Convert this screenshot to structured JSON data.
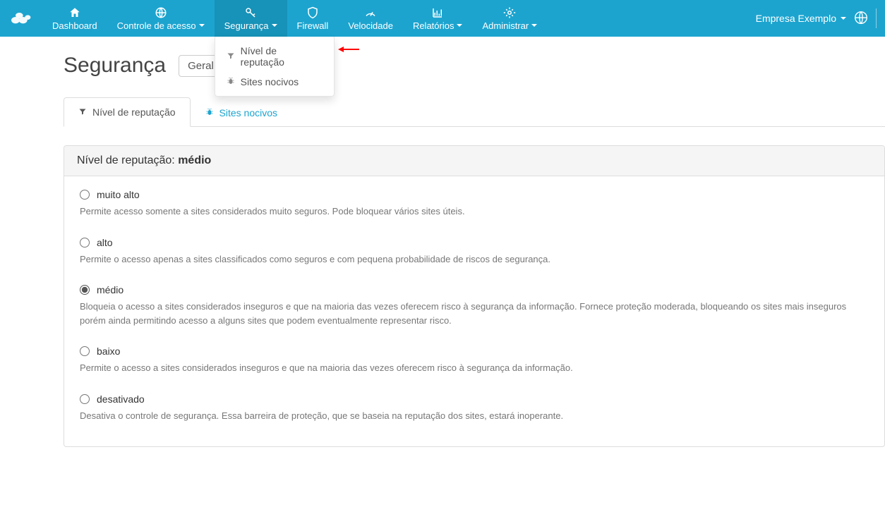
{
  "nav": {
    "items": [
      {
        "label": "Dashboard",
        "caret": false
      },
      {
        "label": "Controle de acesso",
        "caret": true
      },
      {
        "label": "Segurança",
        "caret": true
      },
      {
        "label": "Firewall",
        "caret": false
      },
      {
        "label": "Velocidade",
        "caret": false
      },
      {
        "label": "Relatórios",
        "caret": true
      },
      {
        "label": "Administrar",
        "caret": true
      }
    ]
  },
  "dropdown": {
    "items": [
      {
        "label": "Nível de reputação"
      },
      {
        "label": "Sites nocivos"
      }
    ]
  },
  "company": {
    "label": "Empresa Exemplo"
  },
  "page": {
    "title": "Segurança",
    "select_value": "Geral"
  },
  "tabs": [
    {
      "label": "Nível de reputação"
    },
    {
      "label": "Sites nocivos"
    }
  ],
  "panel": {
    "header_prefix": "Nível de reputação: ",
    "header_value": "médio",
    "options": [
      {
        "label": "muito alto",
        "desc": "Permite acesso somente a sites considerados muito seguros. Pode bloquear vários sites úteis.",
        "checked": false
      },
      {
        "label": "alto",
        "desc": "Permite o acesso apenas a sites classificados como seguros e com pequena probabilidade de riscos de segurança.",
        "checked": false
      },
      {
        "label": "médio",
        "desc": "Bloqueia o acesso a sites considerados inseguros e que na maioria das vezes oferecem risco à segurança da informação. Fornece proteção moderada, bloqueando os sites mais inseguros porém ainda permitindo acesso a alguns sites que podem eventualmente representar risco.",
        "checked": true
      },
      {
        "label": "baixo",
        "desc": "Permite o acesso a sites considerados inseguros e que na maioria das vezes oferecem risco à segurança da informação.",
        "checked": false
      },
      {
        "label": "desativado",
        "desc": "Desativa o controle de segurança. Essa barreira de proteção, que se baseia na reputação dos sites, estará inoperante.",
        "checked": false
      }
    ]
  }
}
